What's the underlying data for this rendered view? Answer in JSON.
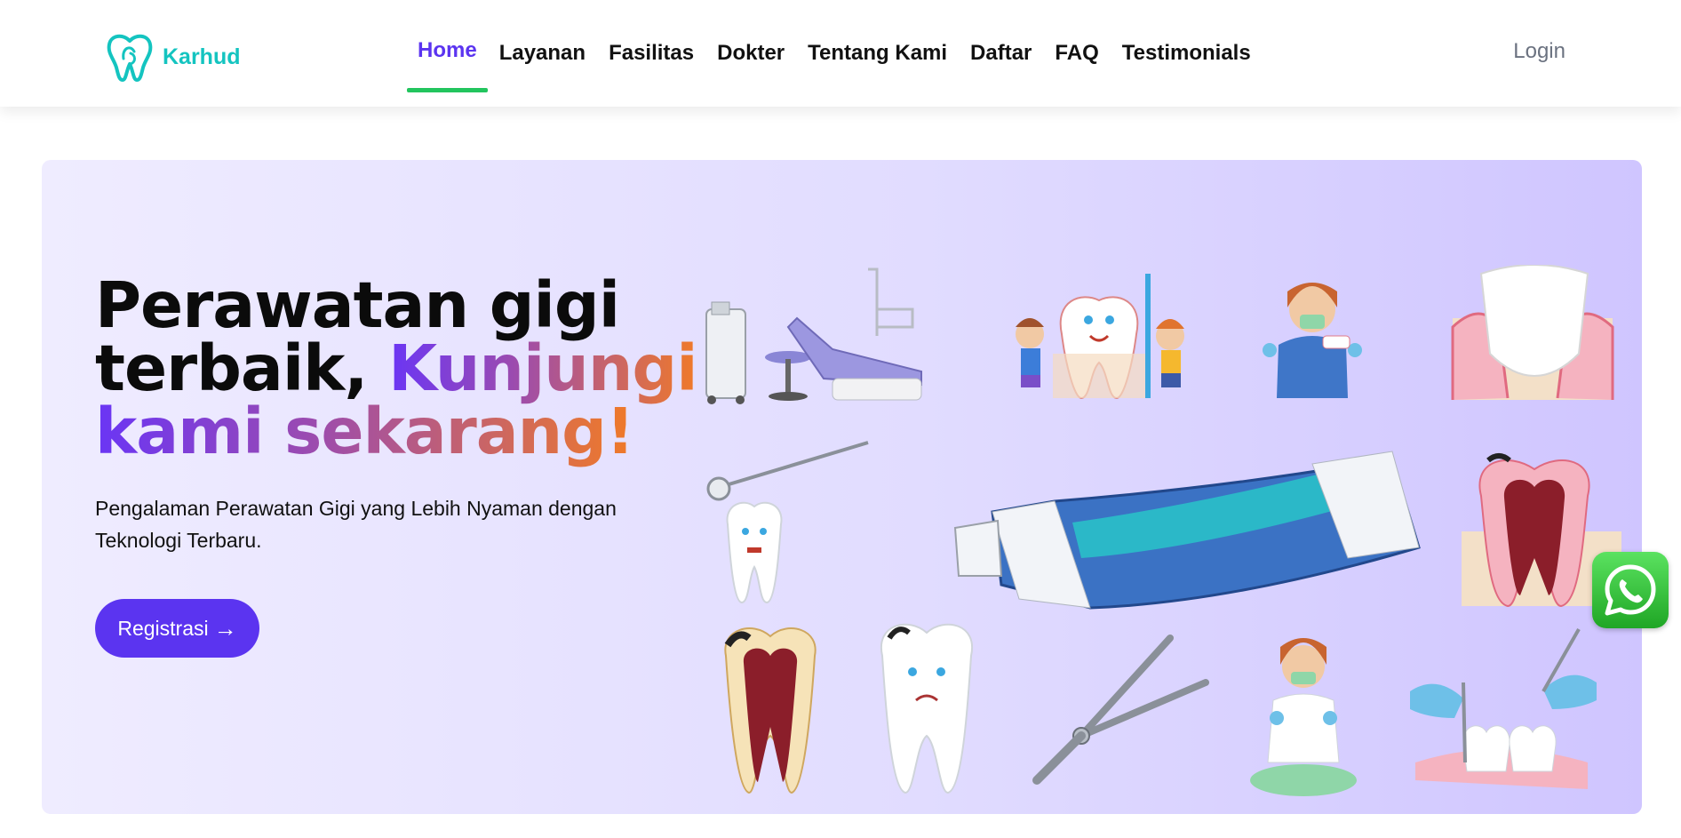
{
  "brand": {
    "name": "Karhud",
    "logo_icon": "tooth-logo-icon",
    "color": "#14c4c0"
  },
  "nav": {
    "items": [
      {
        "label": "Home",
        "active": true
      },
      {
        "label": "Layanan"
      },
      {
        "label": "Fasilitas"
      },
      {
        "label": "Dokter"
      },
      {
        "label": "Tentang Kami"
      },
      {
        "label": "Daftar"
      },
      {
        "label": "FAQ"
      },
      {
        "label": "Testimonials"
      }
    ],
    "login_label": "Login",
    "active_underline_color": "#22c55e",
    "active_color": "#5b34f0"
  },
  "hero": {
    "headline_plain_1": "Perawatan gigi",
    "headline_plain_2": "terbaik,",
    "headline_highlight_1": "Kunjungi",
    "headline_highlight_2": "kami sekarang!",
    "subtitle": "Pengalaman Perawatan Gigi yang Lebih Nyaman dengan Teknologi Terbaru.",
    "cta_label": "Registrasi",
    "cta_icon": "arrow-right-icon",
    "cta_color": "#5b34f0"
  },
  "floating": {
    "whatsapp_icon": "whatsapp-icon",
    "color": "#25d366"
  }
}
